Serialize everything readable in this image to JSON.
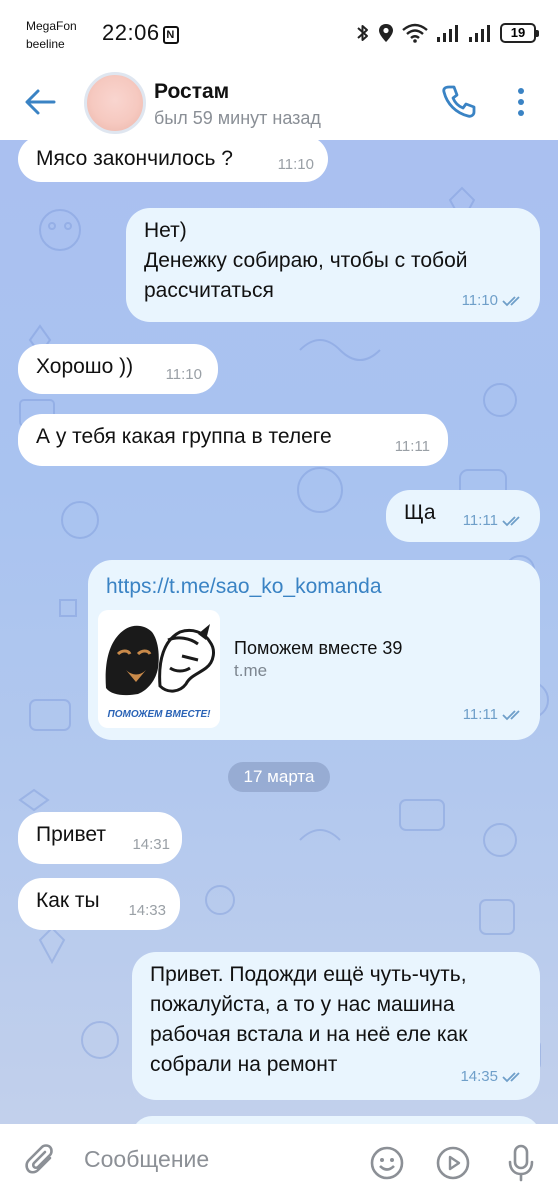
{
  "status_bar": {
    "carrier_1": "MegaFon",
    "carrier_2": "beeline",
    "time": "22:06",
    "nfc_badge": "N",
    "battery": "19",
    "icons": [
      "bluetooth-icon",
      "location-icon",
      "wifi-icon",
      "signal-icon",
      "signal-icon",
      "battery-icon"
    ]
  },
  "header": {
    "back_icon": "arrow-left-icon",
    "contact_name": "Ростам",
    "contact_status": "был 59 минут назад",
    "call_icon": "phone-icon",
    "menu_icon": "more-vertical-icon"
  },
  "messages": [
    {
      "direction": "in",
      "lines": [
        "Мясо закончилось ?"
      ],
      "time": "11:10"
    },
    {
      "direction": "out",
      "lines": [
        "Нет)",
        "Денежку собираю, чтобы с тобой",
        "рассчитаться"
      ],
      "time": "11:10",
      "read": true
    },
    {
      "direction": "in",
      "lines": [
        "Хорошо ))"
      ],
      "time": "11:10"
    },
    {
      "direction": "in",
      "lines": [
        "А у тебя какая группа в телеге"
      ],
      "time": "11:11"
    },
    {
      "direction": "out",
      "lines": [
        "Ща"
      ],
      "time": "11:11",
      "read": true
    },
    {
      "direction": "out",
      "link": "https://t.me/sao_ko_komanda",
      "preview_title": "Поможем вместе 39",
      "preview_site": "t.me",
      "preview_image_caption": "ПОМОЖЕМ ВМЕСТЕ!",
      "time": "11:11",
      "read": true
    },
    {
      "direction": "in",
      "lines": [
        "Привет"
      ],
      "time": "14:31"
    },
    {
      "direction": "in",
      "lines": [
        "Как ты"
      ],
      "time": "14:33"
    },
    {
      "direction": "out",
      "lines": [
        "Привет. Подожди ещё чуть-чуть,",
        "пожалуйста, а то у нас машина",
        "рабочая встала и на неё еле как",
        "собрали на ремонт"
      ],
      "time": "14:35",
      "read": true
    }
  ],
  "date_separator": "17 марта",
  "input": {
    "placeholder": "Сообщение",
    "attach_icon": "paperclip-icon",
    "emoji_icon": "smile-icon",
    "gif_icon": "play-circle-icon",
    "mic_icon": "microphone-icon"
  },
  "colors": {
    "accent": "#3a83c4",
    "incoming_bubble": "#ffffff",
    "outgoing_bubble": "#e9f5fe",
    "chat_background": "#aac0f0",
    "time_in": "#9aa0a6",
    "time_out": "#6f9fc9"
  }
}
